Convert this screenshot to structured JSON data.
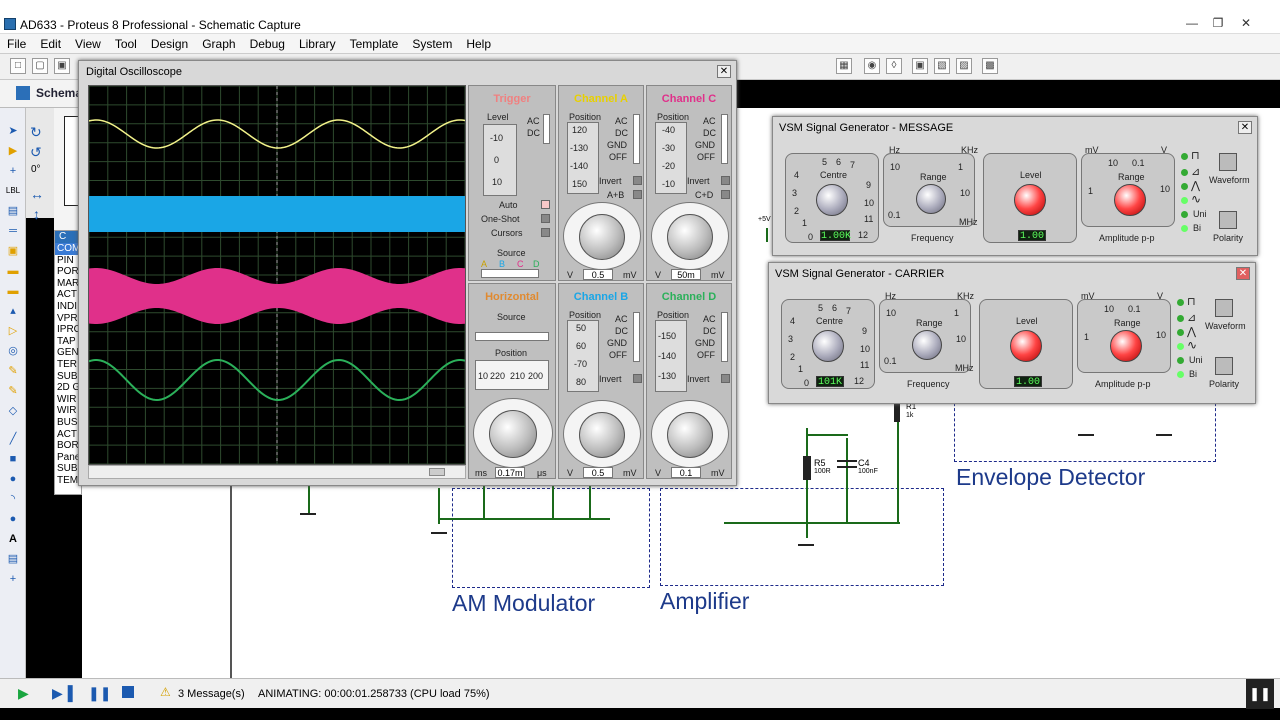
{
  "window": {
    "title": "AD633 - Proteus 8 Professional - Schematic Capture"
  },
  "menu": [
    "File",
    "Edit",
    "View",
    "Tool",
    "Design",
    "Graph",
    "Debug",
    "Library",
    "Template",
    "System",
    "Help"
  ],
  "tab": {
    "label": "Schema"
  },
  "rotation": "0°",
  "device_list": [
    "COM",
    "PIN",
    "POR",
    "MAR",
    "ACT",
    "INDI",
    "VPR",
    "IPRO",
    "TAP",
    "GEN",
    "TER",
    "SUB",
    "2D G",
    "WIR",
    "WIR",
    "BUS",
    "ACT",
    "BOR",
    "Pane",
    "SUB",
    "TEMPLATE"
  ],
  "device_header": "C",
  "schematic": {
    "labels": {
      "am": "AM Modulator",
      "amp": "Amplifier",
      "env": "Envelope Detector"
    },
    "parts": {
      "r5": "R5",
      "r5v": "100R",
      "c4": "C4",
      "c4v": "100nF",
      "r1": "R1",
      "r1v": "1k",
      "plus5": "+5V"
    }
  },
  "oscilloscope": {
    "title": "Digital Oscilloscope",
    "trigger": {
      "title": "Trigger",
      "level": "Level",
      "ac": "AC",
      "dc": "DC",
      "auto": "Auto",
      "oneshot": "One-Shot",
      "cursors": "Cursors",
      "source": "Source",
      "ticks": [
        "-10",
        "0",
        "10"
      ],
      "src": [
        "A",
        "B",
        "C",
        "D"
      ]
    },
    "horizontal": {
      "title": "Horizontal",
      "source": "Source",
      "position": "Position",
      "pos_ticks": [
        "10",
        "220",
        "210",
        "200"
      ],
      "value": "0.17m",
      "unit_l": "ms",
      "unit_r": "μs"
    },
    "channel_a": {
      "title": "Channel A",
      "position": "Position",
      "ticks": [
        "120",
        "-130",
        "-140",
        "150"
      ],
      "ac": "AC",
      "dc": "DC",
      "gnd": "GND",
      "off": "OFF",
      "invert": "Invert",
      "sum": "A+B",
      "value": "0.5",
      "unit_l": "V",
      "unit_r": "mV"
    },
    "channel_b": {
      "title": "Channel B",
      "position": "Position",
      "ticks": [
        "50",
        "60",
        "-70",
        "80"
      ],
      "ac": "AC",
      "dc": "DC",
      "gnd": "GND",
      "off": "OFF",
      "invert": "Invert",
      "value": "0.5",
      "unit_l": "V",
      "unit_r": "mV"
    },
    "channel_c": {
      "title": "Channel C",
      "position": "Position",
      "ticks": [
        "-40",
        "-30",
        "-20",
        "-10"
      ],
      "ac": "AC",
      "dc": "DC",
      "gnd": "GND",
      "off": "OFF",
      "invert": "Invert",
      "sum": "C+D",
      "value": "50m",
      "unit_l": "V",
      "unit_r": "mV"
    },
    "channel_d": {
      "title": "Channel D",
      "position": "Position",
      "ticks": [
        "-150",
        "-140",
        "-130"
      ],
      "ac": "AC",
      "dc": "DC",
      "gnd": "GND",
      "off": "OFF",
      "invert": "Invert",
      "value": "0.1",
      "unit_l": "V",
      "unit_r": "mV"
    },
    "colors": {
      "a": "#f2f28a",
      "b": "#1aa6e6",
      "c": "#e0308a",
      "d": "#2bb05a",
      "trigger": "#f08080",
      "horizontal": "#e08a30"
    }
  },
  "gen_message": {
    "title": "VSM Signal Generator - MESSAGE",
    "centre": "Centre",
    "range": "Range",
    "level": "Level",
    "frequency": "Frequency",
    "amplitude": "Amplitude p-p",
    "centre_value": "1.00K",
    "level_value": "1.00",
    "hz": "Hz",
    "khz": "KHz",
    "mhz": "MHz",
    "mv": "mV",
    "v": "V",
    "range_ticks": [
      "10",
      "0.1",
      "1",
      "10"
    ],
    "amp_range_ticks": [
      "10",
      "0.1",
      "1",
      "10"
    ],
    "dial_ticks": [
      "5",
      "6",
      "7",
      "8",
      "4",
      "9",
      "3",
      "10",
      "2",
      "11",
      "1",
      "0",
      "12"
    ],
    "waveform": "Waveform",
    "polarity": "Polarity",
    "uni": "Uni",
    "bi": "Bi"
  },
  "gen_carrier": {
    "title": "VSM Signal Generator - CARRIER",
    "centre": "Centre",
    "range": "Range",
    "level": "Level",
    "frequency": "Frequency",
    "amplitude": "Amplitude p-p",
    "centre_value": "101K",
    "level_value": "1.00",
    "hz": "Hz",
    "khz": "KHz",
    "mhz": "MHz",
    "mv": "mV",
    "v": "V",
    "range_ticks": [
      "10",
      "0.1",
      "1",
      "10"
    ],
    "amp_range_ticks": [
      "10",
      "0.1",
      "1",
      "10"
    ],
    "dial_ticks": [
      "5",
      "6",
      "7",
      "8",
      "4",
      "9",
      "3",
      "10",
      "2",
      "11",
      "1",
      "0",
      "12"
    ],
    "waveform": "Waveform",
    "polarity": "Polarity",
    "uni": "Uni",
    "bi": "Bi"
  },
  "status": {
    "messages": "3 Message(s)",
    "animating": "ANIMATING: 00:00:01.258733 (CPU load 75%)"
  }
}
